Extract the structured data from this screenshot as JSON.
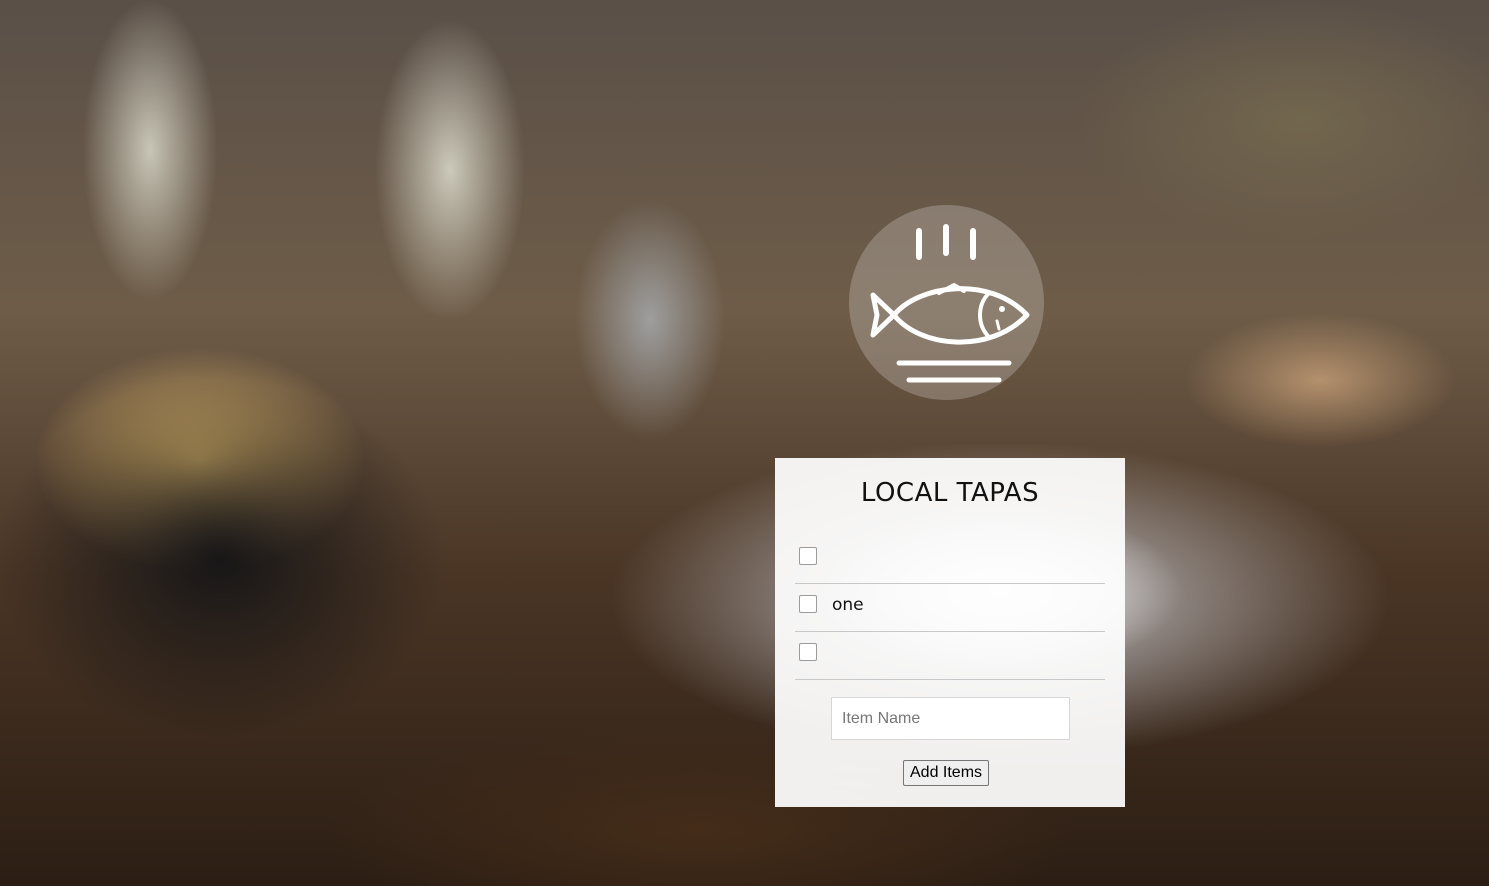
{
  "page": {
    "logo_icon": "fish-on-plate-icon"
  },
  "card": {
    "title": "LOCAL TAPAS",
    "items": [
      {
        "text": "",
        "checked": false
      },
      {
        "text": "one",
        "checked": false
      },
      {
        "text": "",
        "checked": false
      }
    ],
    "input": {
      "value": "",
      "placeholder": "Item Name"
    },
    "add_button_label": "Add Items"
  }
}
